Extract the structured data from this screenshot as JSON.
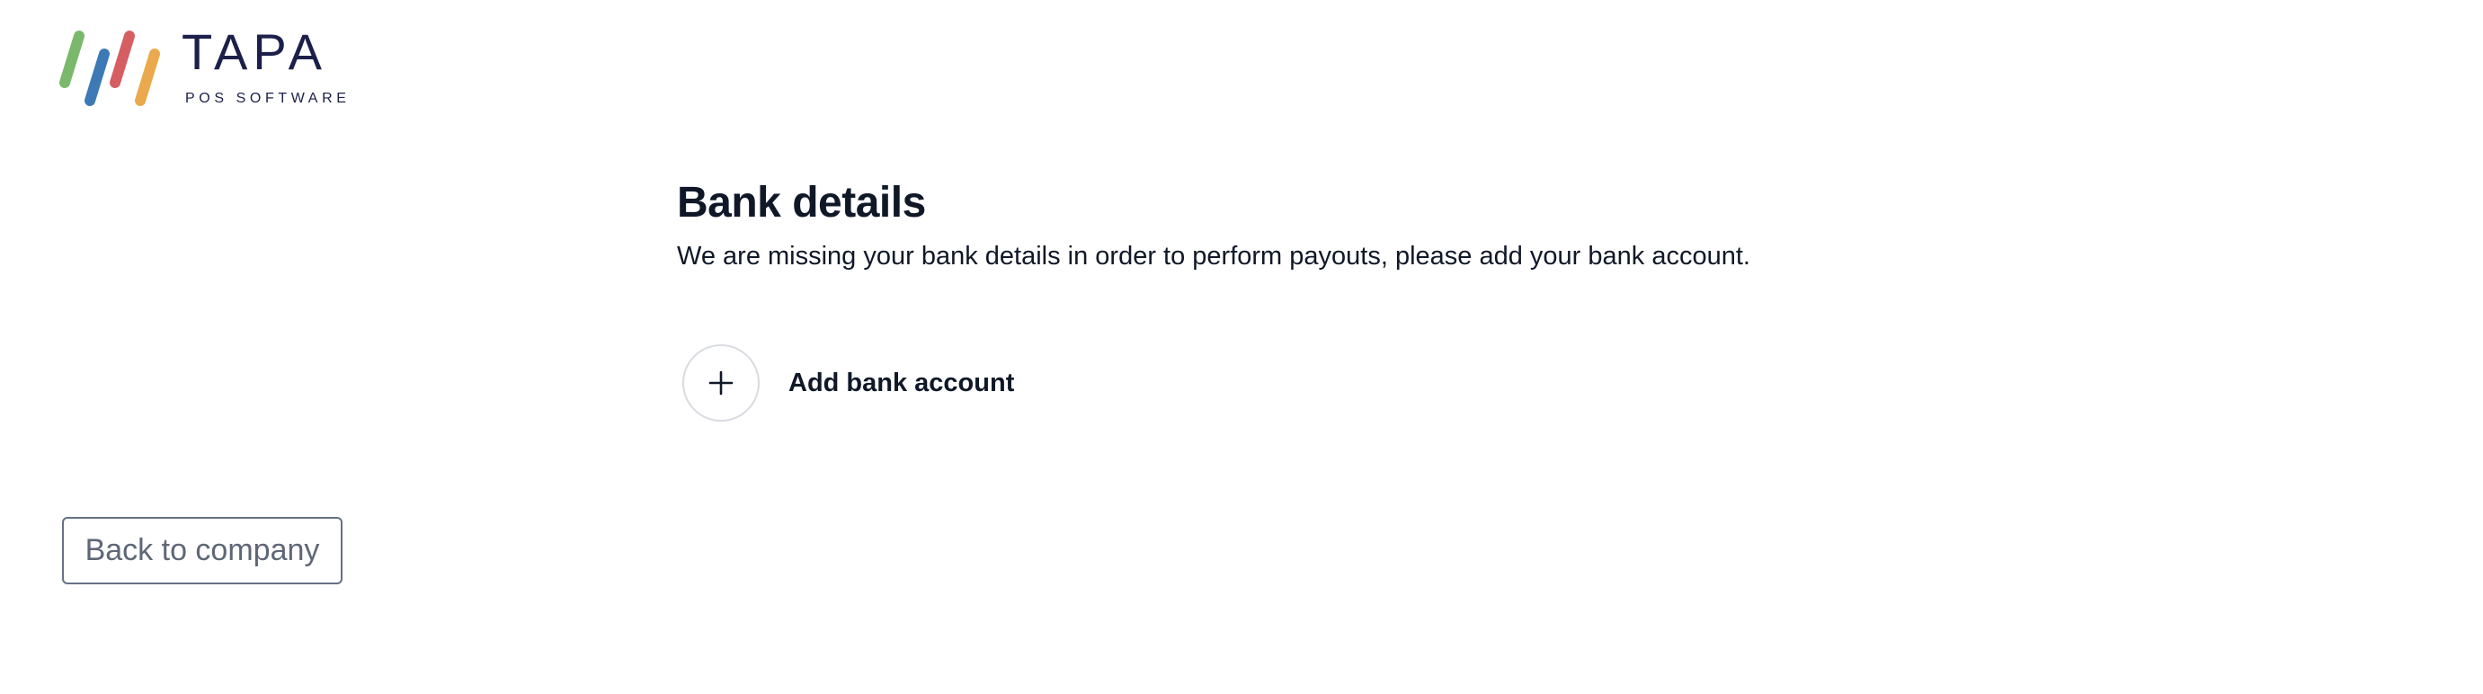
{
  "brand": {
    "name": "TAPA",
    "tagline": "POS SOFTWARE",
    "stripe_colors": [
      "#7ab96b",
      "#3d7ab5",
      "#d65e63",
      "#eaa94c"
    ]
  },
  "bank_details": {
    "title": "Bank details",
    "description": "We are missing your bank details in order to perform payouts, please add your bank account.",
    "add_account": {
      "label": "Add bank account",
      "icon": "plus-icon"
    }
  },
  "navigation": {
    "back_label": "Back to company"
  }
}
